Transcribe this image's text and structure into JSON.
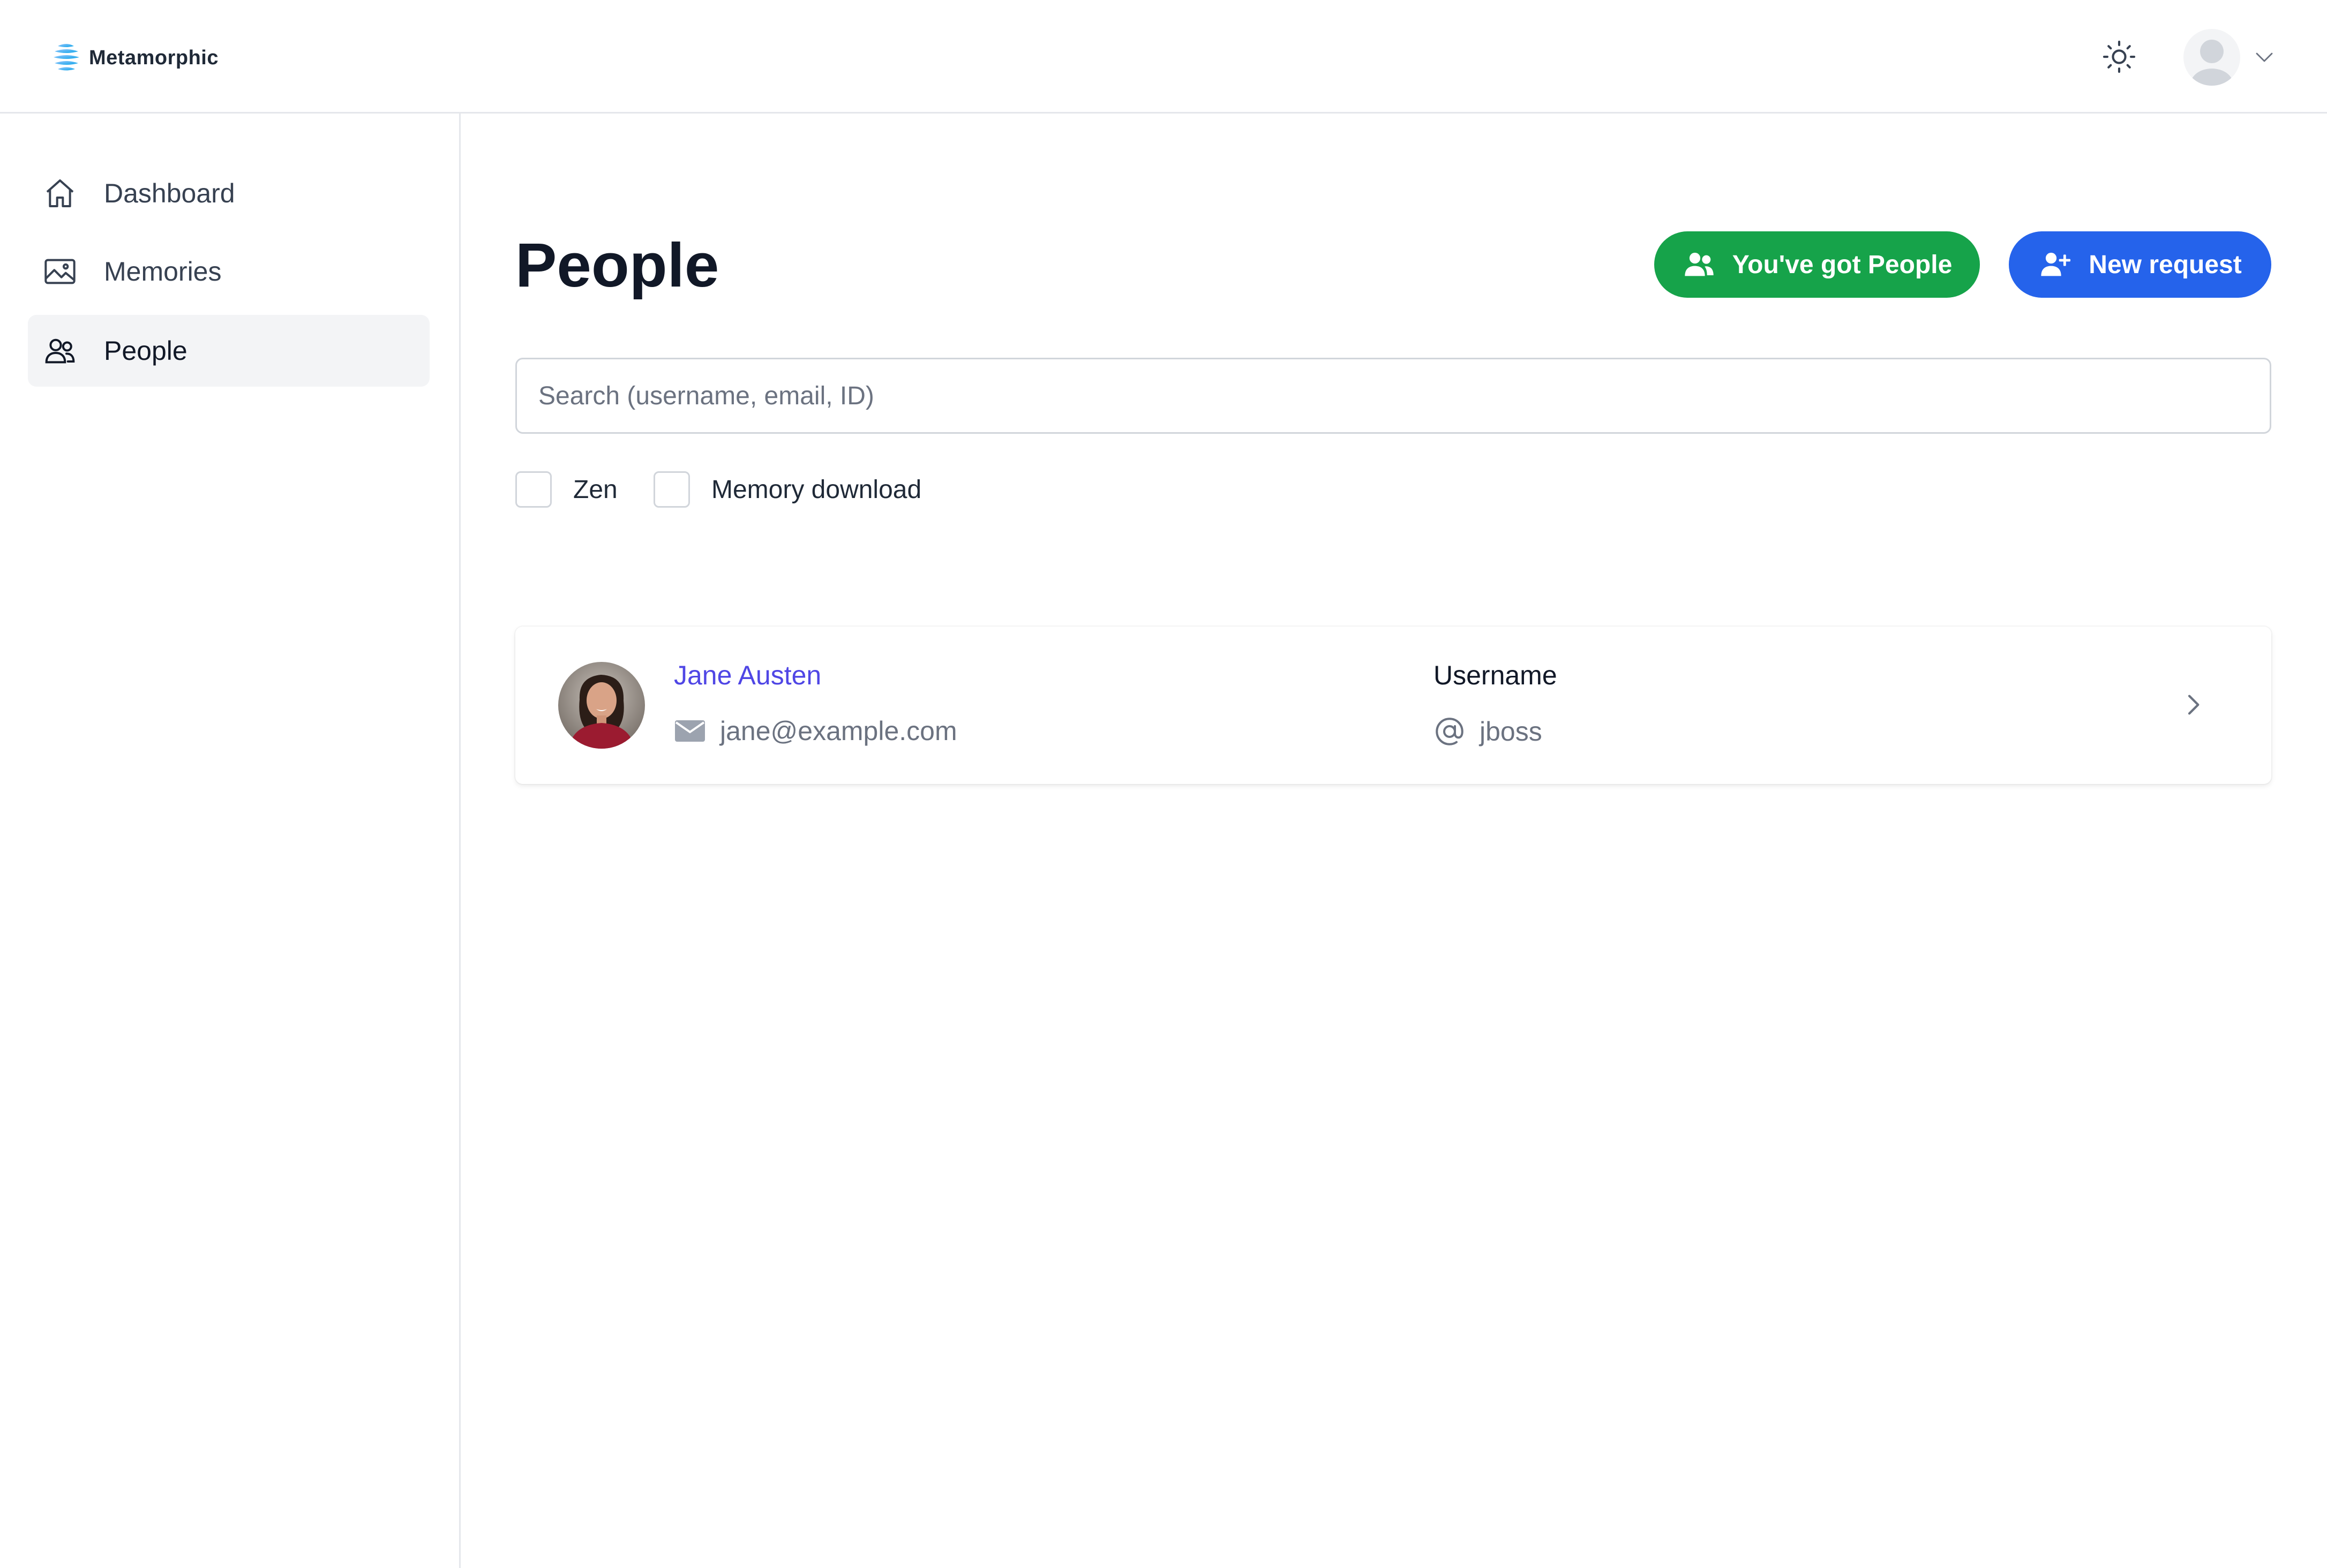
{
  "header": {
    "brand_name": "Metamorphic",
    "theme_icon": "sun-icon",
    "user_icon": "user-avatar-placeholder"
  },
  "sidebar": {
    "items": [
      {
        "label": "Dashboard",
        "icon": "home-icon",
        "active": false
      },
      {
        "label": "Memories",
        "icon": "image-icon",
        "active": false
      },
      {
        "label": "People",
        "icon": "users-icon",
        "active": true
      }
    ]
  },
  "main": {
    "title": "People",
    "actions": {
      "got_people_label": "You've got People",
      "new_request_label": "New request"
    },
    "search": {
      "placeholder": "Search (username, email, ID)",
      "value": ""
    },
    "filters": [
      {
        "label": "Zen",
        "checked": false
      },
      {
        "label": "Memory download",
        "checked": false
      }
    ],
    "people": [
      {
        "name": "Jane Austen",
        "email": "jane@example.com",
        "username_label": "Username",
        "username": "jboss"
      }
    ]
  },
  "colors": {
    "accent_green": "#16a34a",
    "accent_blue": "#2563eb",
    "link_indigo": "#4f46e5"
  }
}
